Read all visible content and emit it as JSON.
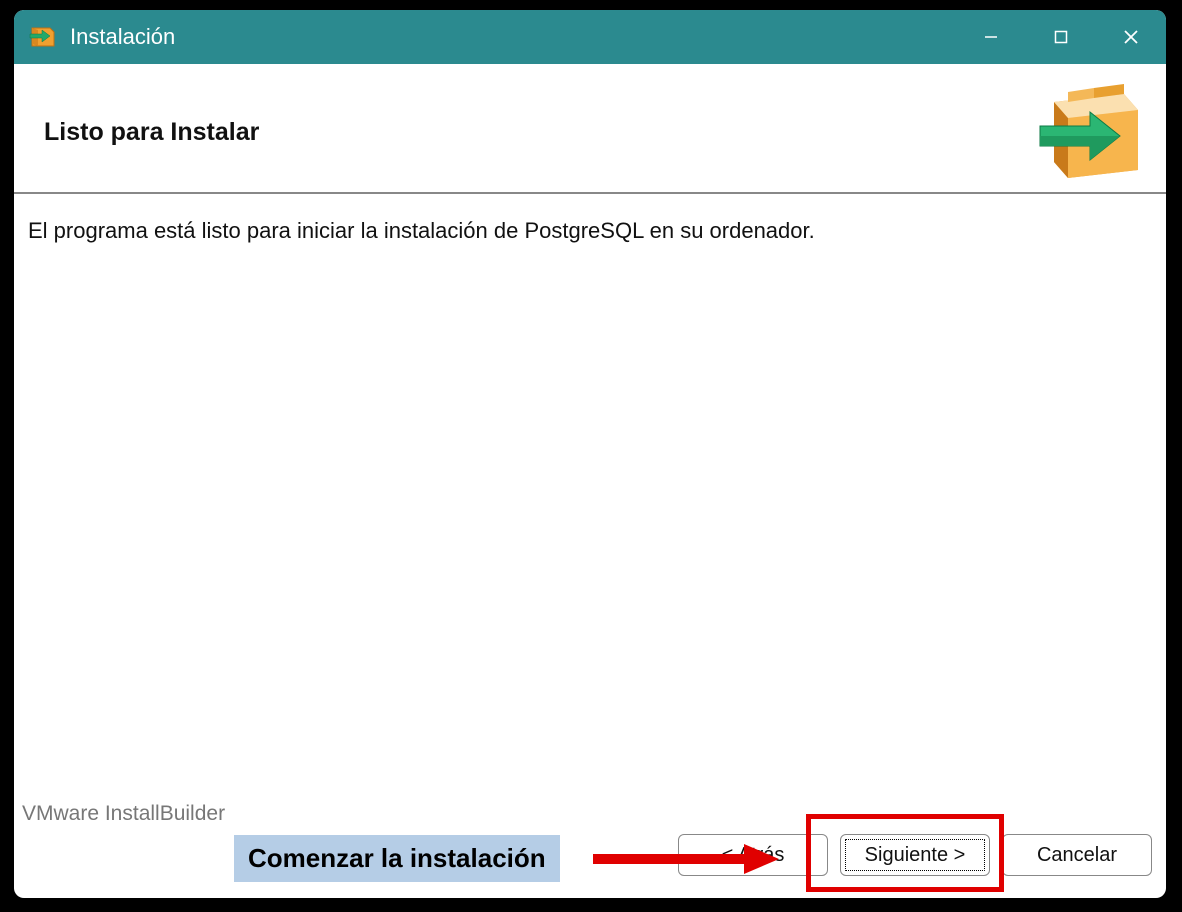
{
  "titlebar": {
    "title": "Instalación"
  },
  "header": {
    "title": "Listo para Instalar"
  },
  "content": {
    "text": "El programa está listo para iniciar la instalación de PostgreSQL en su ordenador."
  },
  "footer": {
    "builder_label": "VMware InstallBuilder",
    "back_label": "< Atrás",
    "next_label": "Siguiente >",
    "cancel_label": "Cancelar"
  },
  "annotation": {
    "label": "Comenzar la instalación"
  }
}
